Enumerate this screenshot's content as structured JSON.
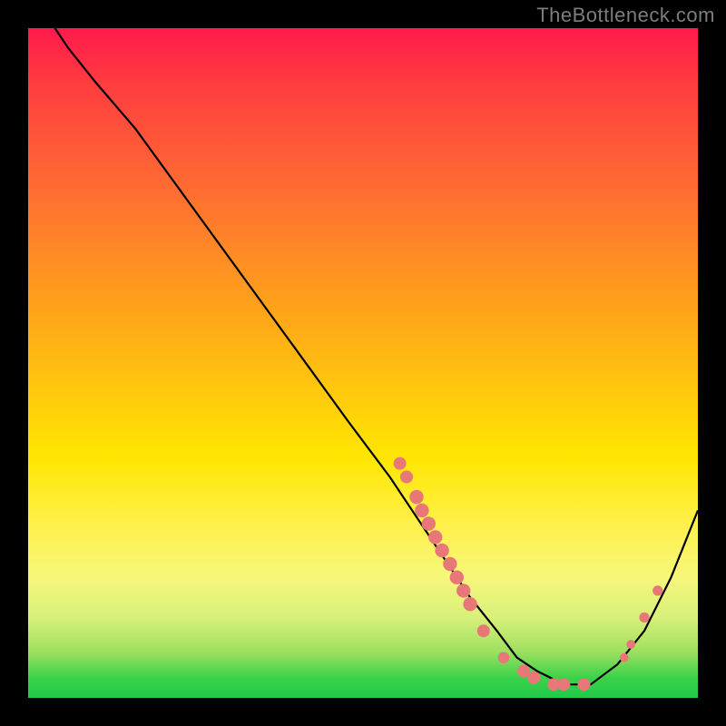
{
  "watermark": "TheBottleneck.com",
  "chart_data": {
    "type": "line",
    "title": "",
    "xlabel": "",
    "ylabel": "",
    "xlim": [
      0,
      100
    ],
    "ylim": [
      0,
      100
    ],
    "grid": false,
    "legend": false,
    "series": [
      {
        "name": "curve",
        "x": [
          4,
          6,
          10,
          16,
          24,
          32,
          40,
          48,
          54,
          58,
          62,
          66,
          70,
          73,
          76,
          80,
          84,
          88,
          92,
          96,
          100
        ],
        "y": [
          100,
          97,
          92,
          85,
          74,
          63,
          52,
          41,
          33,
          27,
          21,
          15,
          10,
          6,
          4,
          2,
          2,
          5,
          10,
          18,
          28
        ]
      }
    ],
    "markers": [
      {
        "x": 55.5,
        "y": 35,
        "r": 1.0
      },
      {
        "x": 56.5,
        "y": 33,
        "r": 1.0
      },
      {
        "x": 58.0,
        "y": 30,
        "r": 1.1
      },
      {
        "x": 58.8,
        "y": 28,
        "r": 1.1
      },
      {
        "x": 59.8,
        "y": 26,
        "r": 1.1
      },
      {
        "x": 60.8,
        "y": 24,
        "r": 1.1
      },
      {
        "x": 61.8,
        "y": 22,
        "r": 1.1
      },
      {
        "x": 63.0,
        "y": 20,
        "r": 1.1
      },
      {
        "x": 64.0,
        "y": 18,
        "r": 1.1
      },
      {
        "x": 65.0,
        "y": 16,
        "r": 1.1
      },
      {
        "x": 66.0,
        "y": 14,
        "r": 1.1
      },
      {
        "x": 68.0,
        "y": 10,
        "r": 1.0
      },
      {
        "x": 71.0,
        "y": 6,
        "r": 0.9
      },
      {
        "x": 74.0,
        "y": 4,
        "r": 1.0
      },
      {
        "x": 75.5,
        "y": 3,
        "r": 1.0
      },
      {
        "x": 78.5,
        "y": 2,
        "r": 1.0
      },
      {
        "x": 80.0,
        "y": 2,
        "r": 1.0
      },
      {
        "x": 83.0,
        "y": 2,
        "r": 1.0
      },
      {
        "x": 89.0,
        "y": 6,
        "r": 0.7
      },
      {
        "x": 90.0,
        "y": 8,
        "r": 0.7
      },
      {
        "x": 92.0,
        "y": 12,
        "r": 0.8
      },
      {
        "x": 94.0,
        "y": 16,
        "r": 0.8
      }
    ],
    "marker_color": "#e87878",
    "curve_color": "#000000"
  }
}
